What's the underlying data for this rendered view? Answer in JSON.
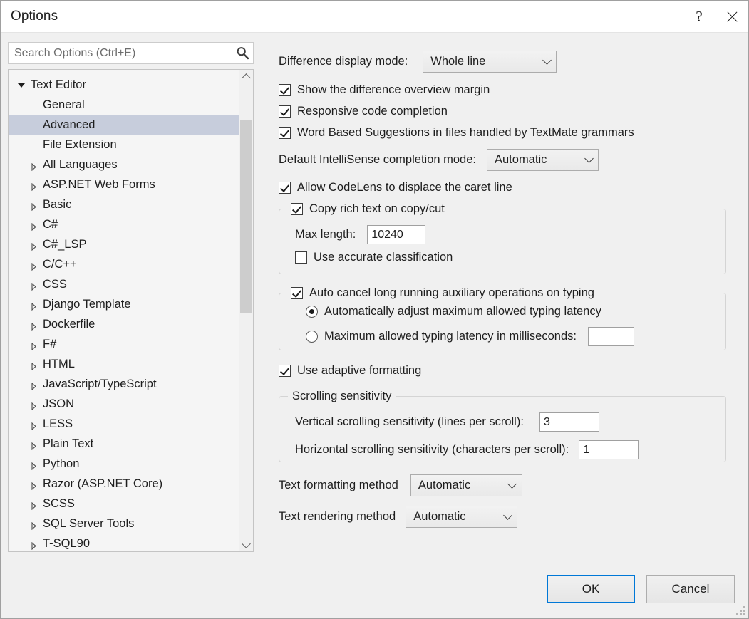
{
  "window": {
    "title": "Options",
    "help_icon": "question-mark-icon",
    "close_icon": "close-icon"
  },
  "search": {
    "placeholder": "Search Options (Ctrl+E)",
    "value": "",
    "icon": "search-icon"
  },
  "tree": {
    "selected": "Advanced",
    "items": [
      {
        "label": "Text Editor",
        "level": 0,
        "expander": "expanded"
      },
      {
        "label": "General",
        "level": 1,
        "expander": "none"
      },
      {
        "label": "Advanced",
        "level": 1,
        "expander": "none",
        "selected": true
      },
      {
        "label": "File Extension",
        "level": 1,
        "expander": "none"
      },
      {
        "label": "All Languages",
        "level": 1,
        "expander": "collapsed"
      },
      {
        "label": "ASP.NET Web Forms",
        "level": 1,
        "expander": "collapsed"
      },
      {
        "label": "Basic",
        "level": 1,
        "expander": "collapsed"
      },
      {
        "label": "C#",
        "level": 1,
        "expander": "collapsed"
      },
      {
        "label": "C#_LSP",
        "level": 1,
        "expander": "collapsed"
      },
      {
        "label": "C/C++",
        "level": 1,
        "expander": "collapsed"
      },
      {
        "label": "CSS",
        "level": 1,
        "expander": "collapsed"
      },
      {
        "label": "Django Template",
        "level": 1,
        "expander": "collapsed"
      },
      {
        "label": "Dockerfile",
        "level": 1,
        "expander": "collapsed"
      },
      {
        "label": "F#",
        "level": 1,
        "expander": "collapsed"
      },
      {
        "label": "HTML",
        "level": 1,
        "expander": "collapsed"
      },
      {
        "label": "JavaScript/TypeScript",
        "level": 1,
        "expander": "collapsed"
      },
      {
        "label": "JSON",
        "level": 1,
        "expander": "collapsed"
      },
      {
        "label": "LESS",
        "level": 1,
        "expander": "collapsed"
      },
      {
        "label": "Plain Text",
        "level": 1,
        "expander": "collapsed"
      },
      {
        "label": "Python",
        "level": 1,
        "expander": "collapsed"
      },
      {
        "label": "Razor (ASP.NET Core)",
        "level": 1,
        "expander": "collapsed"
      },
      {
        "label": "SCSS",
        "level": 1,
        "expander": "collapsed"
      },
      {
        "label": "SQL Server Tools",
        "level": 1,
        "expander": "collapsed"
      },
      {
        "label": "T-SQL90",
        "level": 1,
        "expander": "collapsed"
      }
    ],
    "scrollbar": {
      "up_icon": "chevron-up-icon",
      "down_icon": "chevron-down-icon"
    }
  },
  "options": {
    "difference_display_mode": {
      "label": "Difference display mode:",
      "value": "Whole line"
    },
    "show_difference_overview_margin": {
      "label": "Show the difference overview margin",
      "checked": true
    },
    "responsive_code_completion": {
      "label": "Responsive code completion",
      "checked": true
    },
    "word_based_suggestions": {
      "label": "Word Based Suggestions in files handled by TextMate grammars",
      "checked": true
    },
    "default_intellisense_completion_mode": {
      "label": "Default IntelliSense completion mode:",
      "value": "Automatic"
    },
    "allow_codelens": {
      "label": "Allow CodeLens to displace the caret line",
      "checked": true
    },
    "copy_rich_text_group": {
      "label": "Copy rich text on copy/cut",
      "checked": true,
      "max_length_label": "Max length:",
      "max_length_value": "10240",
      "use_accurate_classification_label": "Use accurate classification",
      "use_accurate_classification_checked": false
    },
    "auto_cancel_group": {
      "label": "Auto cancel long running auxiliary operations on typing",
      "checked": true,
      "radio_auto_label": "Automatically adjust maximum allowed typing latency",
      "radio_auto_selected": true,
      "radio_manual_label": "Maximum allowed typing latency in milliseconds:",
      "radio_manual_selected": false,
      "latency_value": ""
    },
    "use_adaptive_formatting": {
      "label": "Use adaptive formatting",
      "checked": true
    },
    "scrolling_sensitivity_group": {
      "label": "Scrolling sensitivity",
      "vertical_label": "Vertical scrolling sensitivity (lines per scroll):",
      "vertical_value": "3",
      "horizontal_label": "Horizontal scrolling sensitivity (characters per scroll):",
      "horizontal_value": "1"
    },
    "text_formatting_method": {
      "label": "Text formatting method",
      "value": "Automatic"
    },
    "text_rendering_method": {
      "label": "Text rendering method",
      "value": "Automatic"
    }
  },
  "buttons": {
    "ok": "OK",
    "cancel": "Cancel"
  },
  "colors": {
    "dialog_background": "#f0f0f0",
    "titlebar_background": "#ffffff",
    "tree_background": "#f5f5f5",
    "selection": "#c7cddc",
    "default_button_border": "#0078d7",
    "group_border": "#d4d4d4"
  }
}
